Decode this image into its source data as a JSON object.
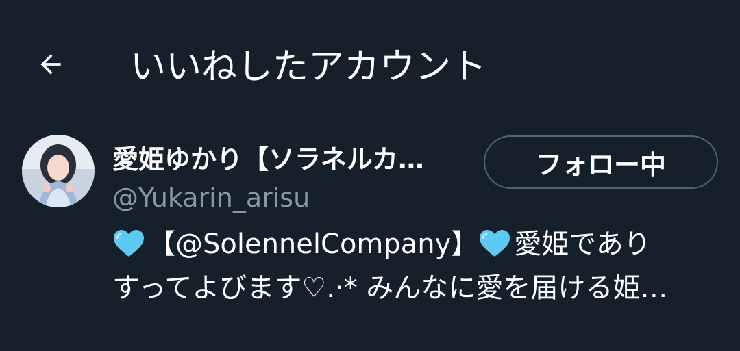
{
  "header": {
    "back_icon": "arrow-left-icon",
    "title": "いいねしたアカウント"
  },
  "user": {
    "avatar_icon": "user-avatar",
    "display_name": "愛姫ゆかり【ソラネルカ…",
    "handle": "@Yukarin_arisu",
    "follow_label": "フォロー中",
    "bio": {
      "heart_icon": "blue-heart-emoji",
      "line1_part1": "【@SolennelCompany】",
      "line1_part2": "愛姫であり",
      "line2": "すってよびます♡.·* みんなに愛を届ける姫…"
    }
  },
  "colors": {
    "background": "#15202b",
    "divider": "#38444d",
    "secondary_text": "#8899a6",
    "button_border": "#536471",
    "heart": "#5ccaf2"
  }
}
